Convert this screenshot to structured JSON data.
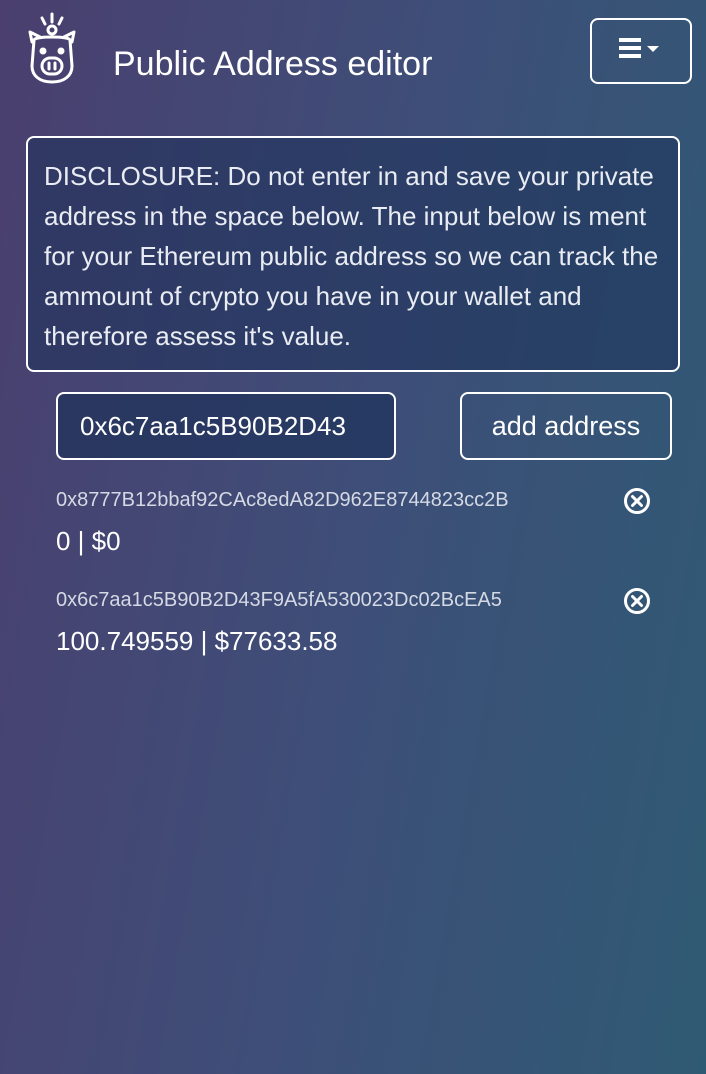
{
  "header": {
    "title": "Public Address editor",
    "logo_icon": "piggy-bank-icon",
    "menu_icon": "hamburger-menu-icon"
  },
  "disclosure": {
    "text": "DISCLOSURE: Do not enter in and save your private address in the space below. The input below is ment for your Ethereum public address so we can track the ammount of crypto you have in your wallet and therefore assess it's value."
  },
  "form": {
    "address_value": "0x6c7aa1c5B90B2D43",
    "add_label": "add address"
  },
  "wallets": [
    {
      "address": "0x8777B12bbaf92CAc8edA82D962E8744823cc2B",
      "value": "0 | $0"
    },
    {
      "address": "0x6c7aa1c5B90B2D43F9A5fA530023Dc02BcEA5",
      "value": "100.749559 | $77633.58"
    }
  ],
  "colors": {
    "background_start": "#4a3f6f",
    "background_end": "#2f5a74",
    "panel": "#2a3d66",
    "border": "#ffffff"
  }
}
